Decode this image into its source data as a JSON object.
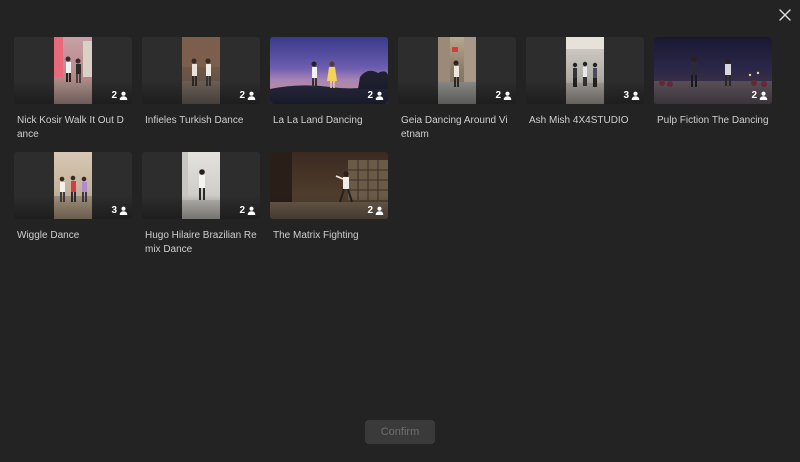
{
  "dialog": {
    "confirm_label": "Confirm"
  },
  "templates": [
    {
      "title": "Nick Kosir Walk It Out Dance",
      "people": "2"
    },
    {
      "title": "Infieles Turkish Dance",
      "people": "2"
    },
    {
      "title": "La La Land Dancing",
      "people": "2"
    },
    {
      "title": "Geia Dancing Around Vietnam",
      "people": "2"
    },
    {
      "title": "Ash Mish 4X4STUDIO",
      "people": "3"
    },
    {
      "title": "Pulp Fiction The Dancing",
      "people": "2"
    },
    {
      "title": "Wiggle Dance",
      "people": "3"
    },
    {
      "title": "Hugo Hilaire Brazilian Remix Dance",
      "people": "2"
    },
    {
      "title": "The Matrix Fighting",
      "people": "2"
    }
  ],
  "icons": {
    "close": "close-icon",
    "person": "person-icon"
  }
}
